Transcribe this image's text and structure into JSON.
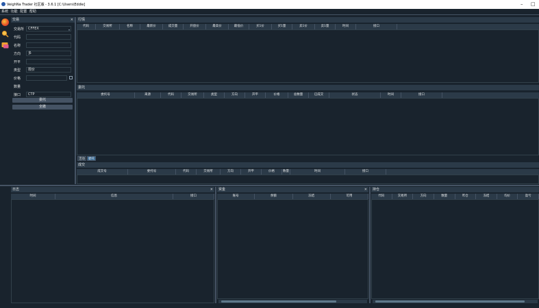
{
  "window": {
    "title": "VeighNa Trader 社区版 - 3.6.1   [C:\\Users\\Eddie]",
    "minimize": "–",
    "maximize": "□"
  },
  "menu": [
    "系统",
    "功能",
    "配置",
    "帮助"
  ],
  "toolbar": {
    "icons": [
      "cube-icon",
      "search-icon",
      "chat-icon"
    ]
  },
  "trading": {
    "title": "交易",
    "close": "×",
    "exchange_label": "交易所",
    "exchange_value": "CFFEX",
    "symbol_label": "代码",
    "name_label": "名称",
    "direction_label": "方向",
    "direction_value": "多",
    "offset_label": "开平",
    "type_label": "类型",
    "type_value": "限价",
    "price_label": "价格",
    "volume_label": "数量",
    "gateway_label": "接口",
    "gateway_value": "CTP",
    "send_button": "委托",
    "cancel_all_button": "全撤"
  },
  "tick": {
    "title": "行情",
    "columns": [
      "代码",
      "交易所",
      "名称",
      "最新价",
      "成交量",
      "开盘价",
      "最高价",
      "最低价",
      "买1价",
      "买1量",
      "卖1价",
      "卖1量",
      "时间",
      "接口"
    ]
  },
  "order": {
    "title": "委托",
    "columns": [
      "委托号",
      "来源",
      "代码",
      "交易所",
      "类型",
      "方向",
      "开平",
      "价格",
      "总数量",
      "已成交",
      "状态",
      "时间",
      "接口"
    ],
    "tabs": [
      "活动",
      "委托"
    ]
  },
  "trade": {
    "title": "成交",
    "columns": [
      "成交号",
      "委托号",
      "代码",
      "交易所",
      "方向",
      "开平",
      "价格",
      "数量",
      "时间",
      "接口"
    ]
  },
  "log": {
    "title": "日志",
    "close": "×",
    "columns": [
      "时间",
      "信息",
      "接口"
    ]
  },
  "account": {
    "title": "资金",
    "close": "×",
    "columns": [
      "账号",
      "余额",
      "冻结",
      "可用"
    ]
  },
  "position": {
    "title": "持仓",
    "columns": [
      "代码",
      "交易所",
      "方向",
      "数量",
      "昨仓",
      "冻结",
      "均价",
      "盈亏"
    ]
  },
  "colors": {
    "background": "#19232d",
    "header": "#2b3a48",
    "border": "#455364",
    "accent": "#346792"
  }
}
